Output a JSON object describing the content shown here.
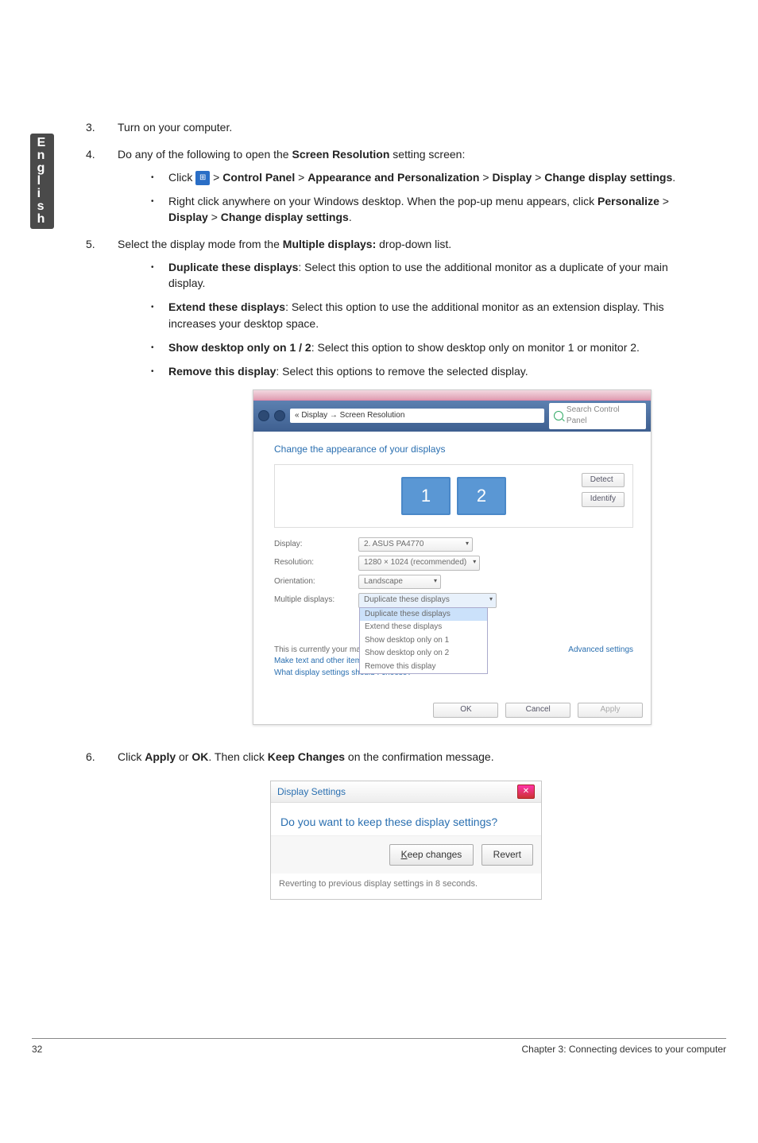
{
  "side_tab": "English",
  "steps": {
    "s3": "Turn on your computer.",
    "s4_lead": "Do any of the following to open the ",
    "s4_bold": "Screen Resolution",
    "s4_tail": " setting screen:",
    "s4a_click": "Click ",
    "s4a_p1": "Control Panel",
    "s4a_p2": "Appearance and Personalization",
    "s4a_p3": "Display",
    "s4a_p4": "Change display settings",
    "s4b_1": "Right click anywhere on your Windows desktop. When the pop-up menu appears, click ",
    "s4b_p1": "Personalize",
    "s4b_p2": "Display",
    "s4b_p3": "Change display settings",
    "s5_lead": "Select the display mode from the ",
    "s5_bold": "Multiple displays:",
    "s5_tail": " drop-down list.",
    "s5a_t": "Duplicate these displays",
    "s5a_d": ": Select this option to use the additional monitor as a duplicate of your main display.",
    "s5b_t": "Extend these displays",
    "s5b_d": ": Select this option to use the additional monitor as an extension display. This increases your desktop space.",
    "s5c_t": "Show desktop only on 1 / 2",
    "s5c_d": ": Select this option to show desktop only on monitor 1 or monitor 2.",
    "s5d_t": "Remove this display",
    "s5d_d": ": Select this options to remove the selected display.",
    "s6_1": "Click ",
    "s6_b1": "Apply",
    "s6_2": " or ",
    "s6_b2": "OK",
    "s6_3": ". Then click ",
    "s6_b3": "Keep Changes",
    "s6_4": " on the confirmation message."
  },
  "scr": {
    "breadcrumb": "« Display → Screen Resolution",
    "search_ph": "Search Control Panel",
    "heading": "Change the appearance of your displays",
    "btn_detect": "Detect",
    "btn_identify": "Identify",
    "mon1": "1",
    "mon2": "2",
    "row_display": "Display:",
    "row_display_val": "2. ASUS PA4770",
    "row_res": "Resolution:",
    "row_res_val": "1280 × 1024 (recommended)",
    "row_orient": "Orientation:",
    "row_orient_val": "Landscape",
    "row_multi": "Multiple displays:",
    "row_multi_val": "Duplicate these displays",
    "dd_opts": [
      "Duplicate these displays",
      "Extend these displays",
      "Show desktop only on 1",
      "Show desktop only on 2",
      "Remove this display"
    ],
    "main_text": "This is currently your main display.",
    "other_text": "Make text and other items larger or smaller",
    "what_text": "What display settings should I choose?",
    "adv": "Advanced settings",
    "ok": "OK",
    "cancel": "Cancel",
    "apply": "Apply"
  },
  "dlg": {
    "title": "Display Settings",
    "question": "Do you want to keep these display settings?",
    "keep": "Keep changes",
    "revert": "Revert",
    "footer": "Reverting to previous display settings in 8 seconds."
  },
  "page_footer": {
    "num": "32",
    "chapter": "Chapter 3: Connecting devices to your computer"
  }
}
